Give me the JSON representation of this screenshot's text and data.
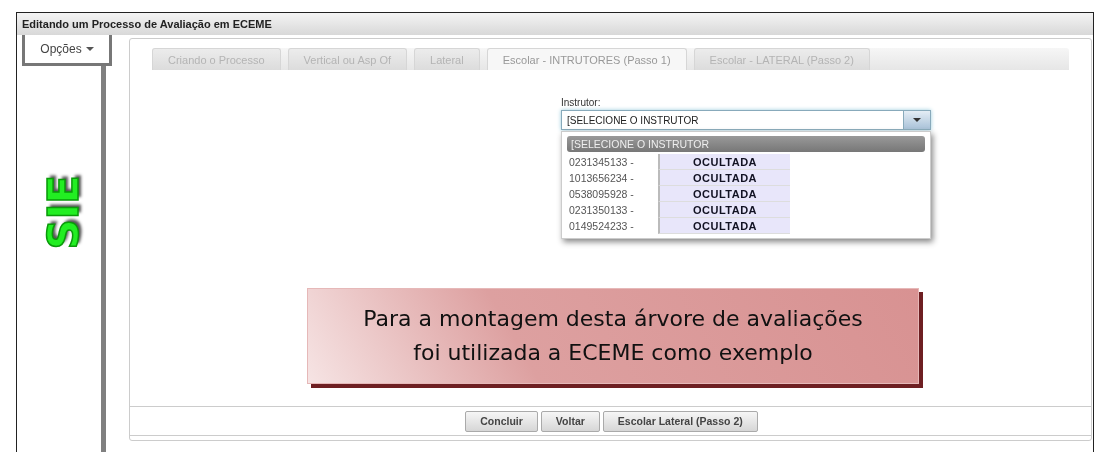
{
  "window": {
    "title": "Editando um Processo de Avaliação em ECEME"
  },
  "options_button": {
    "label": "Opções"
  },
  "logo": {
    "text": "SIE"
  },
  "tabs": [
    {
      "label": "Criando o Processo",
      "selected": false
    },
    {
      "label": "Vertical ou Asp Of",
      "selected": false
    },
    {
      "label": "Lateral",
      "selected": false
    },
    {
      "label": "Escolar - INTRUTORES (Passo 1)",
      "selected": true
    },
    {
      "label": "Escolar - LATERAL (Passo 2)",
      "selected": false
    }
  ],
  "instructor_field": {
    "label": "Instrutor:",
    "value": "[SELECIONE O INSTRUTOR",
    "expanded": true
  },
  "dropdown": {
    "options": [
      {
        "label": "[SELECIONE O INSTRUTOR",
        "selected": true
      },
      {
        "label": "0231345133 -",
        "name": "OCULTADA",
        "selected": false
      },
      {
        "label": "1013656234 -",
        "name": "OCULTADA",
        "selected": false
      },
      {
        "label": "0538095928 -",
        "name": "OCULTADA",
        "selected": false
      },
      {
        "label": "0231350133 -",
        "name": "OCULTADA",
        "selected": false
      },
      {
        "label": "0149524233 -",
        "name": "OCULTADA",
        "selected": false
      }
    ]
  },
  "callout": {
    "lines": [
      "Para a montagem desta árvore de avaliações",
      "foi utilizada a ECEME como exemplo"
    ]
  },
  "buttons": [
    "Concluir",
    "Voltar",
    "Escolar Lateral (Passo 2)"
  ]
}
